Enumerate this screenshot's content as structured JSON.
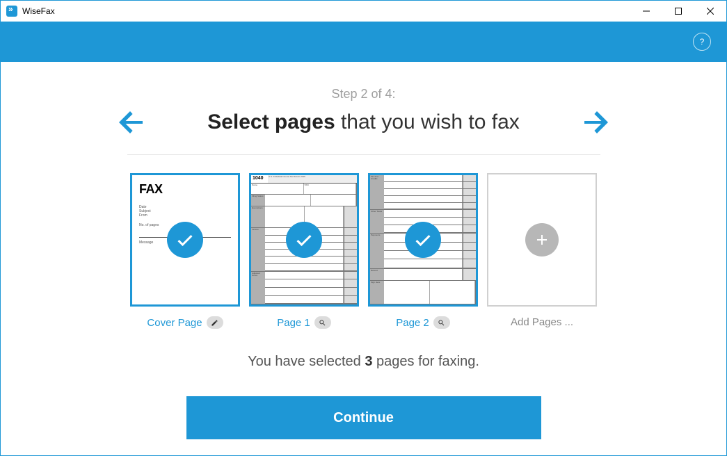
{
  "window": {
    "title": "WiseFax"
  },
  "header": {
    "help_icon": "?"
  },
  "main": {
    "step_text": "Step 2 of 4:",
    "heading_bold": "Select pages",
    "heading_rest": " that you wish to fax",
    "summary_prefix": "You have selected ",
    "summary_count": "3",
    "summary_suffix": " pages for faxing.",
    "continue_label": "Continue"
  },
  "pages": [
    {
      "label": "Cover Page",
      "action_icon": "edit",
      "selected": true,
      "kind": "cover",
      "cover_title": "FAX"
    },
    {
      "label": "Page 1",
      "action_icon": "zoom",
      "selected": true,
      "kind": "form",
      "form_num": "1040"
    },
    {
      "label": "Page 2",
      "action_icon": "zoom",
      "selected": true,
      "kind": "form",
      "form_num": ""
    },
    {
      "label": "Add Pages ...",
      "action_icon": null,
      "selected": false,
      "kind": "add"
    }
  ]
}
